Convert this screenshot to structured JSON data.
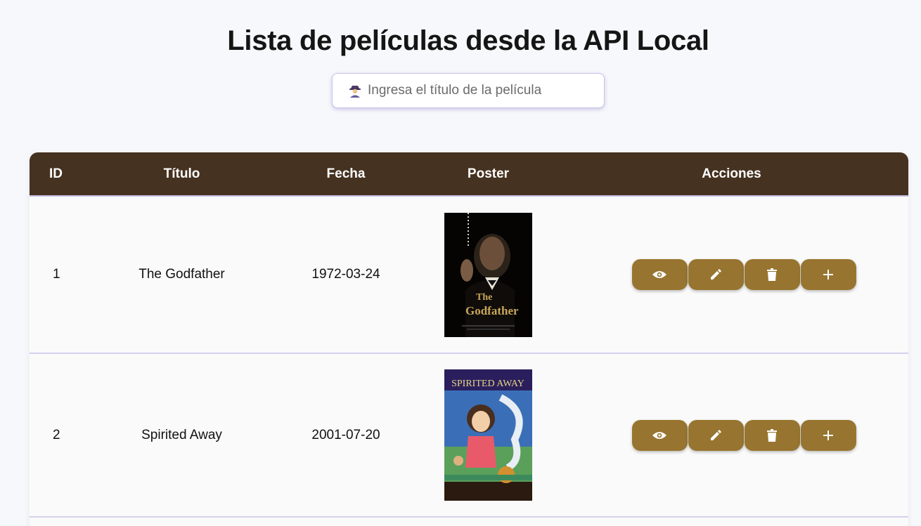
{
  "header": {
    "title": "Lista de películas desde la API Local"
  },
  "search": {
    "placeholder": "Ingresa el título de la película",
    "value": "",
    "icon": "detective-icon"
  },
  "table": {
    "columns": [
      "ID",
      "Título",
      "Fecha",
      "Poster",
      "Acciones"
    ],
    "rows": [
      {
        "id": "1",
        "title": "The Godfather",
        "date": "1972-03-24",
        "poster_title": "The Godfather"
      },
      {
        "id": "2",
        "title": "Spirited Away",
        "date": "2001-07-20",
        "poster_title": "SPIRITED AWAY"
      }
    ],
    "actions": [
      "eye-icon",
      "pencil-icon",
      "trash-icon",
      "plus-icon"
    ]
  },
  "colors": {
    "header_bg": "#463220",
    "action_button": "#977530",
    "page_bg": "#f7f8fb"
  }
}
